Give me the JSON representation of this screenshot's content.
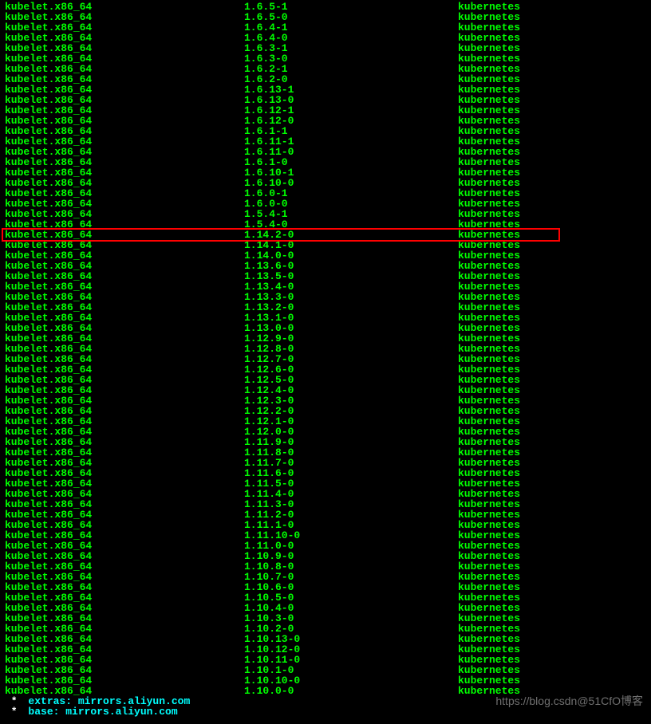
{
  "highlighted_index": 22,
  "packages": [
    {
      "name": "kubelet.x86_64",
      "version": "1.6.5-1",
      "repo": "kubernetes"
    },
    {
      "name": "kubelet.x86_64",
      "version": "1.6.5-0",
      "repo": "kubernetes"
    },
    {
      "name": "kubelet.x86_64",
      "version": "1.6.4-1",
      "repo": "kubernetes"
    },
    {
      "name": "kubelet.x86_64",
      "version": "1.6.4-0",
      "repo": "kubernetes"
    },
    {
      "name": "kubelet.x86_64",
      "version": "1.6.3-1",
      "repo": "kubernetes"
    },
    {
      "name": "kubelet.x86_64",
      "version": "1.6.3-0",
      "repo": "kubernetes"
    },
    {
      "name": "kubelet.x86_64",
      "version": "1.6.2-1",
      "repo": "kubernetes"
    },
    {
      "name": "kubelet.x86_64",
      "version": "1.6.2-0",
      "repo": "kubernetes"
    },
    {
      "name": "kubelet.x86_64",
      "version": "1.6.13-1",
      "repo": "kubernetes"
    },
    {
      "name": "kubelet.x86_64",
      "version": "1.6.13-0",
      "repo": "kubernetes"
    },
    {
      "name": "kubelet.x86_64",
      "version": "1.6.12-1",
      "repo": "kubernetes"
    },
    {
      "name": "kubelet.x86_64",
      "version": "1.6.12-0",
      "repo": "kubernetes"
    },
    {
      "name": "kubelet.x86_64",
      "version": "1.6.1-1",
      "repo": "kubernetes"
    },
    {
      "name": "kubelet.x86_64",
      "version": "1.6.11-1",
      "repo": "kubernetes"
    },
    {
      "name": "kubelet.x86_64",
      "version": "1.6.11-0",
      "repo": "kubernetes"
    },
    {
      "name": "kubelet.x86_64",
      "version": "1.6.1-0",
      "repo": "kubernetes"
    },
    {
      "name": "kubelet.x86_64",
      "version": "1.6.10-1",
      "repo": "kubernetes"
    },
    {
      "name": "kubelet.x86_64",
      "version": "1.6.10-0",
      "repo": "kubernetes"
    },
    {
      "name": "kubelet.x86_64",
      "version": "1.6.0-1",
      "repo": "kubernetes"
    },
    {
      "name": "kubelet.x86_64",
      "version": "1.6.0-0",
      "repo": "kubernetes"
    },
    {
      "name": "kubelet.x86_64",
      "version": "1.5.4-1",
      "repo": "kubernetes"
    },
    {
      "name": "kubelet.x86_64",
      "version": "1.5.4-0",
      "repo": "kubernetes"
    },
    {
      "name": "kubelet.x86_64",
      "version": "1.14.2-0",
      "repo": "kubernetes"
    },
    {
      "name": "kubelet.x86_64",
      "version": "1.14.1-0",
      "repo": "kubernetes"
    },
    {
      "name": "kubelet.x86_64",
      "version": "1.14.0-0",
      "repo": "kubernetes"
    },
    {
      "name": "kubelet.x86_64",
      "version": "1.13.6-0",
      "repo": "kubernetes"
    },
    {
      "name": "kubelet.x86_64",
      "version": "1.13.5-0",
      "repo": "kubernetes"
    },
    {
      "name": "kubelet.x86_64",
      "version": "1.13.4-0",
      "repo": "kubernetes"
    },
    {
      "name": "kubelet.x86_64",
      "version": "1.13.3-0",
      "repo": "kubernetes"
    },
    {
      "name": "kubelet.x86_64",
      "version": "1.13.2-0",
      "repo": "kubernetes"
    },
    {
      "name": "kubelet.x86_64",
      "version": "1.13.1-0",
      "repo": "kubernetes"
    },
    {
      "name": "kubelet.x86_64",
      "version": "1.13.0-0",
      "repo": "kubernetes"
    },
    {
      "name": "kubelet.x86_64",
      "version": "1.12.9-0",
      "repo": "kubernetes"
    },
    {
      "name": "kubelet.x86_64",
      "version": "1.12.8-0",
      "repo": "kubernetes"
    },
    {
      "name": "kubelet.x86_64",
      "version": "1.12.7-0",
      "repo": "kubernetes"
    },
    {
      "name": "kubelet.x86_64",
      "version": "1.12.6-0",
      "repo": "kubernetes"
    },
    {
      "name": "kubelet.x86_64",
      "version": "1.12.5-0",
      "repo": "kubernetes"
    },
    {
      "name": "kubelet.x86_64",
      "version": "1.12.4-0",
      "repo": "kubernetes"
    },
    {
      "name": "kubelet.x86_64",
      "version": "1.12.3-0",
      "repo": "kubernetes"
    },
    {
      "name": "kubelet.x86_64",
      "version": "1.12.2-0",
      "repo": "kubernetes"
    },
    {
      "name": "kubelet.x86_64",
      "version": "1.12.1-0",
      "repo": "kubernetes"
    },
    {
      "name": "kubelet.x86_64",
      "version": "1.12.0-0",
      "repo": "kubernetes"
    },
    {
      "name": "kubelet.x86_64",
      "version": "1.11.9-0",
      "repo": "kubernetes"
    },
    {
      "name": "kubelet.x86_64",
      "version": "1.11.8-0",
      "repo": "kubernetes"
    },
    {
      "name": "kubelet.x86_64",
      "version": "1.11.7-0",
      "repo": "kubernetes"
    },
    {
      "name": "kubelet.x86_64",
      "version": "1.11.6-0",
      "repo": "kubernetes"
    },
    {
      "name": "kubelet.x86_64",
      "version": "1.11.5-0",
      "repo": "kubernetes"
    },
    {
      "name": "kubelet.x86_64",
      "version": "1.11.4-0",
      "repo": "kubernetes"
    },
    {
      "name": "kubelet.x86_64",
      "version": "1.11.3-0",
      "repo": "kubernetes"
    },
    {
      "name": "kubelet.x86_64",
      "version": "1.11.2-0",
      "repo": "kubernetes"
    },
    {
      "name": "kubelet.x86_64",
      "version": "1.11.1-0",
      "repo": "kubernetes"
    },
    {
      "name": "kubelet.x86_64",
      "version": "1.11.10-0",
      "repo": "kubernetes"
    },
    {
      "name": "kubelet.x86_64",
      "version": "1.11.0-0",
      "repo": "kubernetes"
    },
    {
      "name": "kubelet.x86_64",
      "version": "1.10.9-0",
      "repo": "kubernetes"
    },
    {
      "name": "kubelet.x86_64",
      "version": "1.10.8-0",
      "repo": "kubernetes"
    },
    {
      "name": "kubelet.x86_64",
      "version": "1.10.7-0",
      "repo": "kubernetes"
    },
    {
      "name": "kubelet.x86_64",
      "version": "1.10.6-0",
      "repo": "kubernetes"
    },
    {
      "name": "kubelet.x86_64",
      "version": "1.10.5-0",
      "repo": "kubernetes"
    },
    {
      "name": "kubelet.x86_64",
      "version": "1.10.4-0",
      "repo": "kubernetes"
    },
    {
      "name": "kubelet.x86_64",
      "version": "1.10.3-0",
      "repo": "kubernetes"
    },
    {
      "name": "kubelet.x86_64",
      "version": "1.10.2-0",
      "repo": "kubernetes"
    },
    {
      "name": "kubelet.x86_64",
      "version": "1.10.13-0",
      "repo": "kubernetes"
    },
    {
      "name": "kubelet.x86_64",
      "version": "1.10.12-0",
      "repo": "kubernetes"
    },
    {
      "name": "kubelet.x86_64",
      "version": "1.10.11-0",
      "repo": "kubernetes"
    },
    {
      "name": "kubelet.x86_64",
      "version": "1.10.1-0",
      "repo": "kubernetes"
    },
    {
      "name": "kubelet.x86_64",
      "version": "1.10.10-0",
      "repo": "kubernetes"
    },
    {
      "name": "kubelet.x86_64",
      "version": "1.10.0-0",
      "repo": "kubernetes"
    }
  ],
  "footer": [
    "extras: mirrors.aliyun.com",
    "base: mirrors.aliyun.com"
  ],
  "watermark": "https://blog.csdn@51CfO博客"
}
